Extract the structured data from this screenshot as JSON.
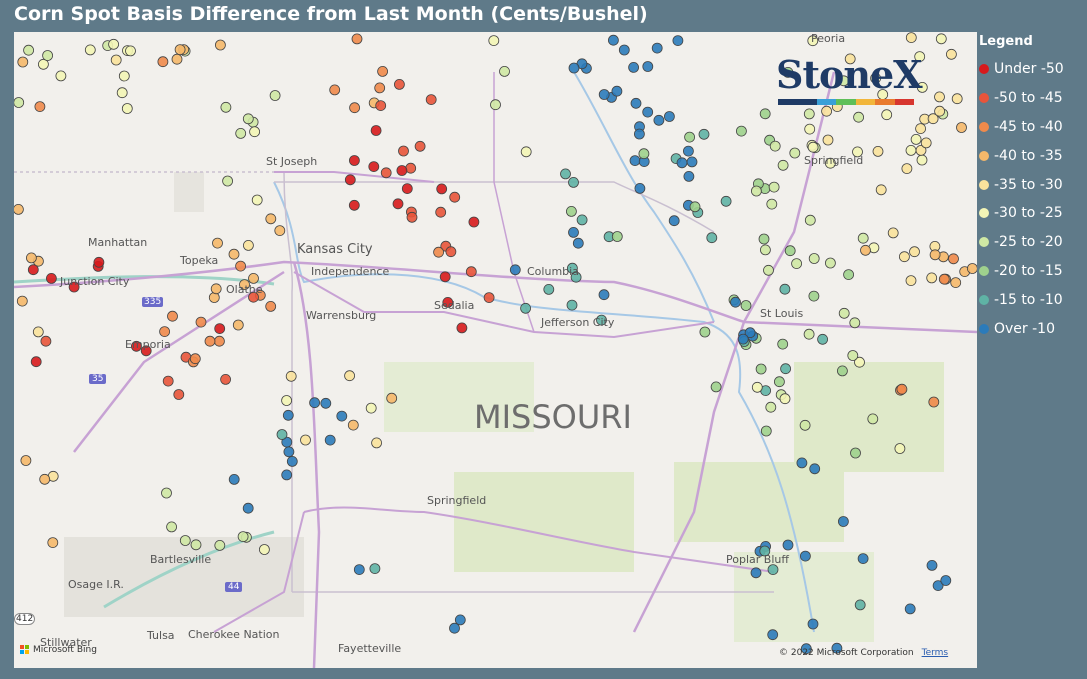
{
  "title": "Corn Spot Basis Difference from Last Month (Cents/Bushel)",
  "legend": {
    "title": "Legend",
    "items": [
      {
        "label": "Under -50",
        "color": "#d7191c"
      },
      {
        "label": "-50 to -45",
        "color": "#e8543a"
      },
      {
        "label": "-45 to -40",
        "color": "#f08a4b"
      },
      {
        "label": "-40 to -35",
        "color": "#f5b86a"
      },
      {
        "label": "-35 to -30",
        "color": "#fae29c"
      },
      {
        "label": "-30 to -25",
        "color": "#f3f5b6"
      },
      {
        "label": "-25 to -20",
        "color": "#cfe8a4"
      },
      {
        "label": "-20 to -15",
        "color": "#9fd18d"
      },
      {
        "label": "-15 to -10",
        "color": "#5fb3a5"
      },
      {
        "label": "Over -10",
        "color": "#2b7bba"
      }
    ]
  },
  "map": {
    "region_label": "MISSOURI",
    "places": [
      "St Joseph",
      "Manhattan",
      "Topeka",
      "Kansas City",
      "Independence",
      "Junction City",
      "Olathe",
      "Columbia",
      "Warrensburg",
      "Sedalia",
      "Jefferson City",
      "St Louis",
      "Emporia",
      "Springfield",
      "Springfield",
      "Bartlesville",
      "Osage I.R.",
      "Poplar Bluff",
      "Tulsa",
      "Cherokee Nation",
      "Stillwater",
      "Fayetteville",
      "Peoria"
    ],
    "route_shields": [
      "335",
      "35",
      "44",
      "412"
    ]
  },
  "brand": {
    "name": "StoneX"
  },
  "attribution": {
    "provider": "Microsoft Bing",
    "copyright": "© 2022 Microsoft Corporation",
    "terms": "Terms"
  }
}
